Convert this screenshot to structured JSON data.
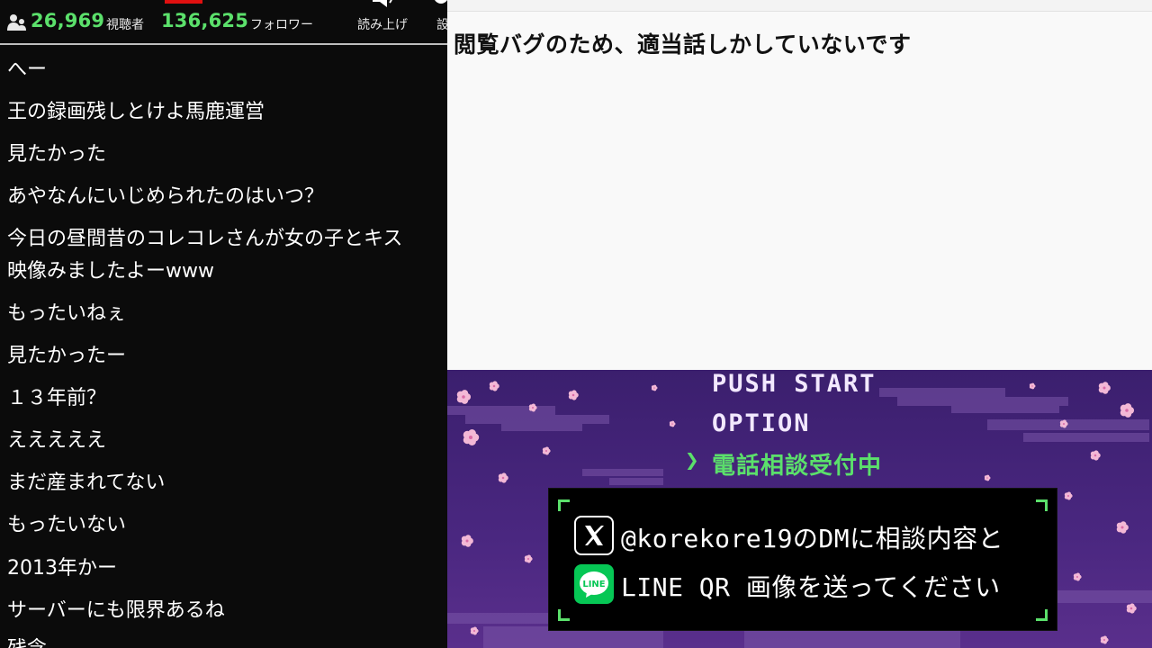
{
  "stats": {
    "viewers": "26,969",
    "viewers_label": "視聴者",
    "followers": "136,625",
    "followers_label": "フォロワー",
    "tools": [
      "読み上げ",
      "設"
    ]
  },
  "comments": [
    "へー",
    "王の録画残しとけよ馬鹿運営",
    "見たかった",
    "あやなんにいじめられたのはいつ？",
    "今日の昼間昔のコレコレさんが女の子とキス",
    "映像みましたよーwww",
    "もったいねぇ",
    "見たかったー",
    "１３年前？",
    "えええええ",
    "まだ産まれてない",
    "もったいない",
    "2013年かー",
    "サーバーにも限界あるね",
    "残念"
  ],
  "notepad": {
    "text": "閲覧バグのため、適当話しかしていないです"
  },
  "game": {
    "menu": {
      "push_start": "PUSH START",
      "option": "OPTION",
      "selected": "電話相談受付中",
      "cursor": "❯"
    },
    "dialog": {
      "line1": "@korekore19のDMに相談内容と",
      "line2": "LINE QR 画像を送ってください",
      "line_icon_label": "LINE"
    }
  },
  "colors": {
    "accent_green": "#5be06b",
    "menu_text": "#f2e8ff",
    "sky_top": "#3b1f6e",
    "sky_bottom": "#5a2f8c",
    "line_green": "#06c755"
  },
  "icons": [
    "viewer-icon",
    "speaker-icon",
    "settings-icon",
    "x-logo-icon",
    "line-logo-icon"
  ]
}
